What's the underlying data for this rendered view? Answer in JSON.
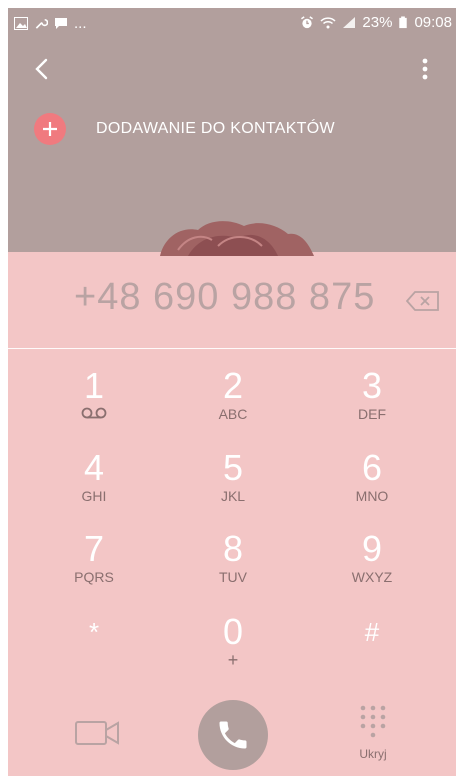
{
  "status_bar": {
    "left_icons": [
      "image-icon",
      "wrench-icon",
      "message-icon"
    ],
    "more": "...",
    "right_icons": [
      "alarm-icon",
      "wifi-icon",
      "signal-icon"
    ],
    "battery": "23%",
    "time": "09:08"
  },
  "header": {
    "add_contact_label": "DODAWANIE DO KONTAKTÓW"
  },
  "dialer": {
    "number": "+48 690 988 875",
    "keys": [
      {
        "digit": "1",
        "letters": "voicemail"
      },
      {
        "digit": "2",
        "letters": "ABC"
      },
      {
        "digit": "3",
        "letters": "DEF"
      },
      {
        "digit": "4",
        "letters": "GHI"
      },
      {
        "digit": "5",
        "letters": "JKL"
      },
      {
        "digit": "6",
        "letters": "MNO"
      },
      {
        "digit": "7",
        "letters": "PQRS"
      },
      {
        "digit": "8",
        "letters": "TUV"
      },
      {
        "digit": "9",
        "letters": "WXYZ"
      },
      {
        "digit": "*",
        "letters": ""
      },
      {
        "digit": "0",
        "letters": "+"
      },
      {
        "digit": "#",
        "letters": ""
      }
    ]
  },
  "actions": {
    "hide_label": "Ukryj"
  },
  "colors": {
    "top_background": "#b29f9d",
    "dialer_background": "#f3c6c6",
    "accent": "#f07a7f"
  }
}
